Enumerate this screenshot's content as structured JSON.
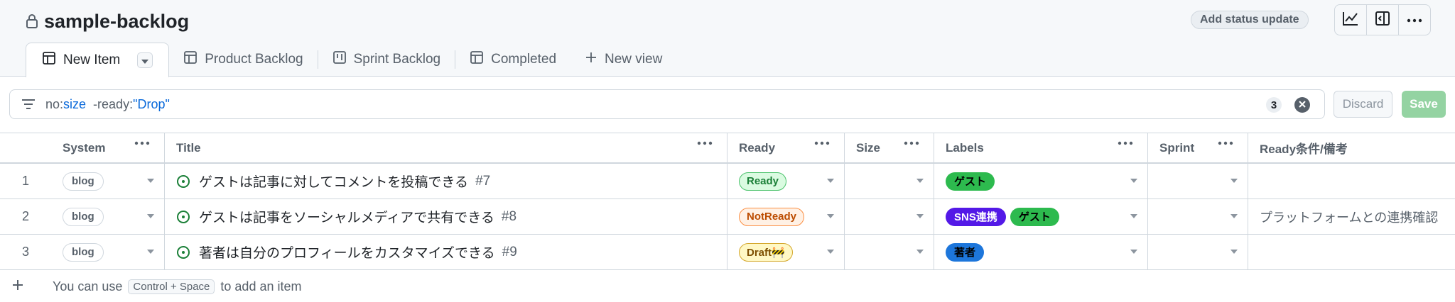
{
  "project": {
    "title": "sample-backlog"
  },
  "header": {
    "status_button": "Add status update",
    "icons": [
      "chart-icon",
      "side-panel-icon",
      "more-icon"
    ]
  },
  "tabs": [
    {
      "label": "New Item",
      "icon": "table-icon",
      "active": true
    },
    {
      "label": "Product Backlog",
      "icon": "table-icon"
    },
    {
      "label": "Sprint Backlog",
      "icon": "board-icon"
    },
    {
      "label": "Completed",
      "icon": "table-icon"
    },
    {
      "label": "New view",
      "icon": "plus-icon"
    }
  ],
  "filter": {
    "key1": "no:",
    "val1": "size",
    "key2": "  -ready:",
    "val2": "\"Drop\"",
    "count": "3"
  },
  "actions": {
    "discard": "Discard",
    "save": "Save"
  },
  "columns": [
    "System",
    "Title",
    "Ready",
    "Size",
    "Labels",
    "Sprint",
    "Ready条件/備考"
  ],
  "rows": [
    {
      "num": "1",
      "system": "blog",
      "title": "ゲストは記事に対してコメントを投稿できる",
      "issue": "#7",
      "ready": "Ready",
      "labels": [
        "ゲスト"
      ],
      "cond": ""
    },
    {
      "num": "2",
      "system": "blog",
      "title": "ゲストは記事をソーシャルメディアで共有できる",
      "issue": "#8",
      "ready": "NotReady",
      "labels": [
        "SNS連携",
        "ゲスト"
      ],
      "cond": "プラットフォームとの連携確認"
    },
    {
      "num": "3",
      "system": "blog",
      "title": "著者は自分のプロフィールをカスタマイズできる",
      "issue": "#9",
      "ready": "Draft🚧",
      "labels": [
        "著者"
      ],
      "cond": ""
    }
  ],
  "add_item": {
    "pre": "You can use",
    "kbd": "Control + Space",
    "post": "to add an item"
  },
  "colors": {
    "ready_green": "#1a7f37",
    "notready_orange": "#bc4c00",
    "draft_yellow": "#7d4e00",
    "label_guest": "#2dba4e",
    "label_sns": "#5319e7",
    "label_author": "#1d76db",
    "open_issue": "#1a7f37"
  }
}
